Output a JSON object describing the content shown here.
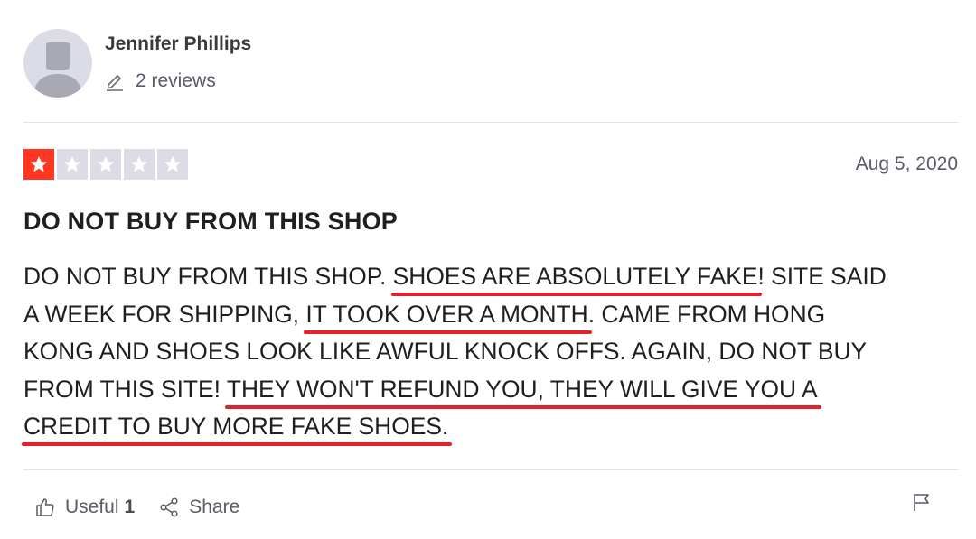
{
  "reviewer": {
    "name": "Jennifer Phillips",
    "reviews_count": "2 reviews"
  },
  "review": {
    "rating": 1,
    "max_rating": 5,
    "date": "Aug 5, 2020",
    "title": "DO NOT BUY FROM THIS SHOP",
    "body": {
      "l1a": "DO NOT BUY FROM THIS SHOP. ",
      "l1b": "SHOES ARE ABSOLUTELY FAKE",
      "l1c": "! SITE SAID",
      "l2a": "A WEEK FOR SHIPPING, ",
      "l2b": "IT TOOK OVER A MONTH",
      "l2c": ". CAME FROM HONG",
      "l3": "KONG AND SHOES LOOK LIKE AWFUL KNOCK OFFS. AGAIN, DO NOT BUY",
      "l4a": "FROM THIS SITE! ",
      "l4b": "THEY WON'T REFUND YOU, THEY WILL GIVE YOU A",
      "l5": "CREDIT TO BUY MORE FAKE SHOES."
    },
    "annotation_color": "#e3222e"
  },
  "actions": {
    "useful_label": "Useful",
    "useful_count": "1",
    "share_label": "Share"
  },
  "icons": {
    "avatar": "user-silhouette-icon",
    "pen": "pencil-icon",
    "star": "star-icon",
    "thumbs_up": "thumbs-up-icon",
    "share": "share-icon",
    "flag": "flag-icon"
  },
  "colors": {
    "star_active": "#ff3722",
    "star_inactive": "#dcdce6",
    "muted_text": "#5a5a66"
  }
}
